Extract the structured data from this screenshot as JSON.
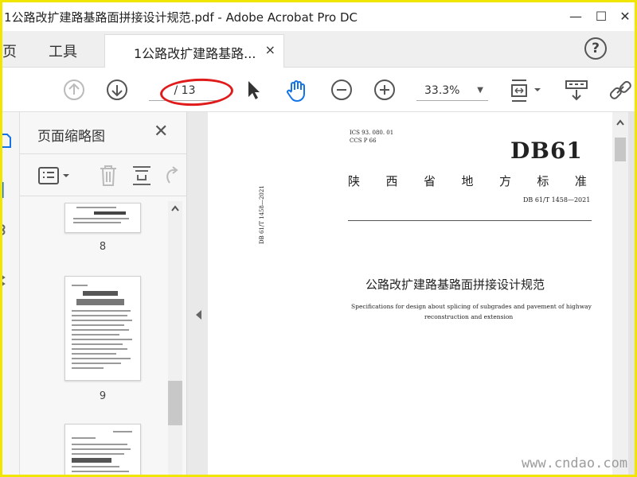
{
  "window": {
    "title": "1公路改扩建路基路面拼接设计规范.pdf - Adobe Acrobat Pro DC",
    "minimize": "—",
    "maximize": "☐",
    "close": "✕"
  },
  "tabs": {
    "home": "主页",
    "tools": "工具",
    "document": "1公路改扩建路基路...",
    "close": "×",
    "help": "?"
  },
  "toolbar": {
    "page_display": "/ 13",
    "zoom": "33.3%"
  },
  "panel": {
    "title": "页面缩略图",
    "close": "✕",
    "thumbnails": [
      {
        "page": "8"
      },
      {
        "page": "9"
      }
    ]
  },
  "document": {
    "ics": "ICS 93. 080. 01",
    "ccs": "CCS P 66",
    "logo": "DB61",
    "province": [
      "陕",
      "西",
      "省",
      "地",
      "方",
      "标",
      "准"
    ],
    "std_number": "DB 61/T 1458—2021",
    "side_number": "DB 61/T 1458—2021",
    "title_cn": "公路改扩建路基路面拼接设计规范",
    "title_en_1": "Specifications for design about splicing of subgrades and pavement of highway",
    "title_en_2": "reconstruction and extension"
  },
  "watermark": "www.cndao.com",
  "colors": {
    "frame": "#f0e600",
    "annotation": "#e01b1b",
    "accent_blue": "#1473e6"
  }
}
